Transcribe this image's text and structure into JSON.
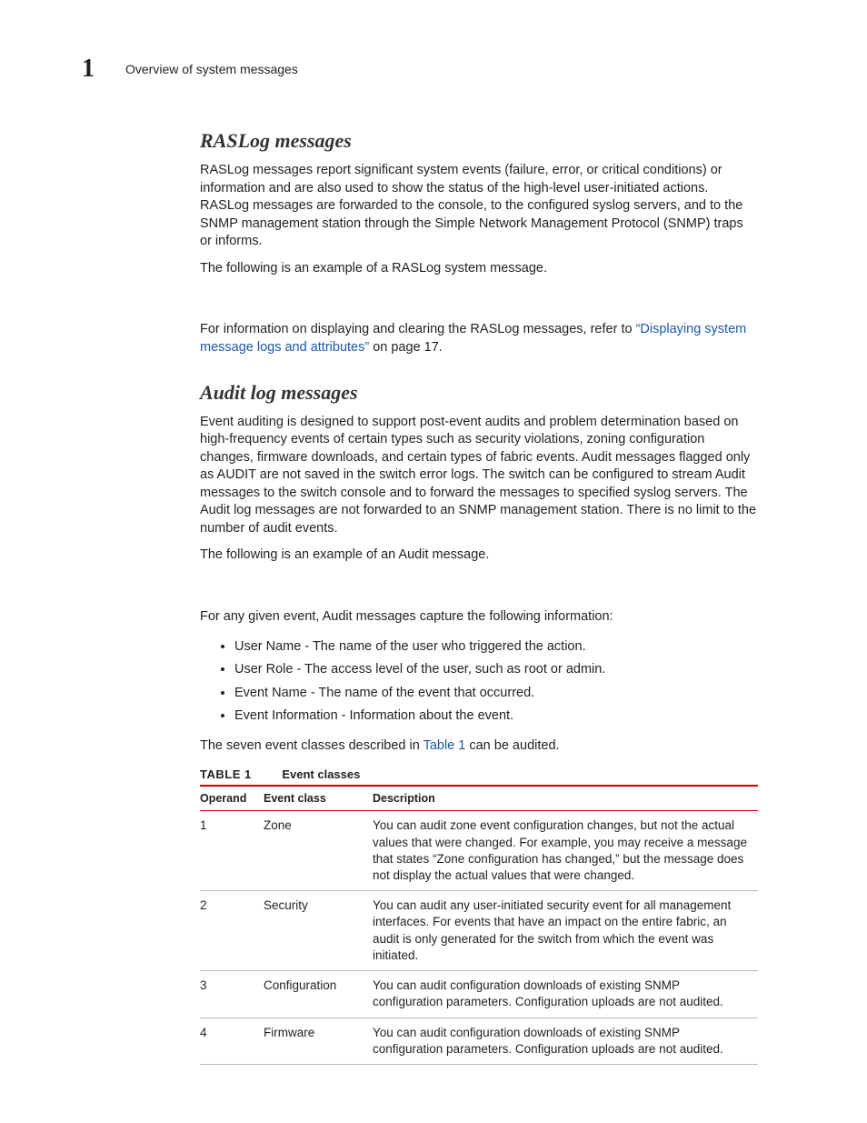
{
  "header": {
    "chapter_number": "1",
    "chapter_title": "Overview of system messages"
  },
  "sections": {
    "raslog": {
      "heading": "RASLog messages",
      "p1": "RASLog messages report significant system events (failure, error, or critical conditions) or information and are also used to show the status of the high-level user-initiated actions. RASLog messages are forwarded to the console, to the configured syslog servers, and to the SNMP management station through the Simple Network Management Protocol (SNMP) traps or informs.",
      "p2": "The following is an example of a RASLog system message.",
      "p3_pre": "For information on displaying and clearing the RASLog messages, refer to ",
      "p3_link": "“Displaying system message logs and attributes”",
      "p3_post": " on page 17."
    },
    "audit": {
      "heading": "Audit log messages",
      "p1": "Event auditing is designed to support post-event audits and problem determination based on high-frequency events of certain types such as security violations, zoning configuration changes, firmware downloads, and certain types of fabric events. Audit messages flagged only as AUDIT are not saved in the switch error logs. The switch can be configured to stream Audit messages to the switch console and to forward the messages to specified syslog servers. The Audit log messages are not forwarded to an SNMP management station. There is no limit to the number of audit events.",
      "p2": "The following is an example of an Audit message.",
      "p3": "For any given event, Audit messages capture the following information:",
      "bullets": [
        "User Name - The name of the user who triggered the action.",
        "User Role - The access level of the user, such as root or admin.",
        "Event Name - The name of the event that occurred.",
        "Event Information - Information about the event."
      ],
      "p4_pre": "The seven event classes described in ",
      "p4_link": "Table 1",
      "p4_post": " can be audited."
    }
  },
  "table": {
    "label": "TABLE 1",
    "caption": "Event classes",
    "headers": {
      "c1": "Operand",
      "c2": "Event class",
      "c3": "Description"
    },
    "rows": [
      {
        "operand": "1",
        "class": "Zone",
        "desc": "You can audit zone event configuration changes, but not the actual values that were changed. For example, you may receive a message that states “Zone configuration has changed,” but the message does not display the actual values that were changed."
      },
      {
        "operand": "2",
        "class": "Security",
        "desc": "You can audit any user-initiated security event for all management interfaces. For events that have an impact on the entire fabric, an audit is only generated for the switch from which the event was initiated."
      },
      {
        "operand": "3",
        "class": "Configuration",
        "desc": "You can audit configuration downloads of existing SNMP configuration parameters. Configuration uploads are not audited."
      },
      {
        "operand": "4",
        "class": "Firmware",
        "desc": "You can audit configuration downloads of existing SNMP configuration parameters. Configuration uploads are not audited."
      }
    ]
  },
  "chart_data": {
    "type": "table",
    "title": "Event classes",
    "columns": [
      "Operand",
      "Event class",
      "Description"
    ],
    "rows": [
      [
        "1",
        "Zone",
        "You can audit zone event configuration changes, but not the actual values that were changed. For example, you may receive a message that states “Zone configuration has changed,” but the message does not display the actual values that were changed."
      ],
      [
        "2",
        "Security",
        "You can audit any user-initiated security event for all management interfaces. For events that have an impact on the entire fabric, an audit is only generated for the switch from which the event was initiated."
      ],
      [
        "3",
        "Configuration",
        "You can audit configuration downloads of existing SNMP configuration parameters. Configuration uploads are not audited."
      ],
      [
        "4",
        "Firmware",
        "You can audit configuration downloads of existing SNMP configuration parameters. Configuration uploads are not audited."
      ]
    ]
  }
}
